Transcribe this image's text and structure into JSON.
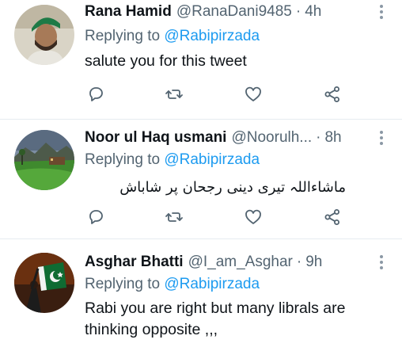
{
  "tweets": [
    {
      "name": "Rana Hamid",
      "handle": "@RanaDani9485",
      "time": "4h",
      "replying_prefix": "Replying to",
      "replying_to": "@Rabipirzada",
      "text": "salute you for this tweet",
      "avatar_icon": "avatar-man-green-cap"
    },
    {
      "name": "Noor ul Haq usmani",
      "handle": "@Noorulh...",
      "time": "8h",
      "replying_prefix": "Replying to",
      "replying_to": "@Rabipirzada",
      "text": "ماشاءاللہ تیری دینی رجحان پر شاباش",
      "avatar_icon": "avatar-landscape"
    },
    {
      "name": "Asghar Bhatti",
      "handle": "@I_am_Asghar",
      "time": "9h",
      "replying_prefix": "Replying to",
      "replying_to": "@Rabipirzada",
      "text": "Rabi you are right but many librals are thinking opposite ,,,",
      "avatar_icon": "avatar-pakistan-flag"
    }
  ],
  "separator": "·",
  "icons": {
    "reply": "reply-icon",
    "retweet": "retweet-icon",
    "like": "like-icon",
    "share": "share-icon",
    "more": "more-icon"
  },
  "colors": {
    "link": "#1d9bf0",
    "secondary": "#536471",
    "text": "#0f1419",
    "divider": "#e6ecf0"
  }
}
